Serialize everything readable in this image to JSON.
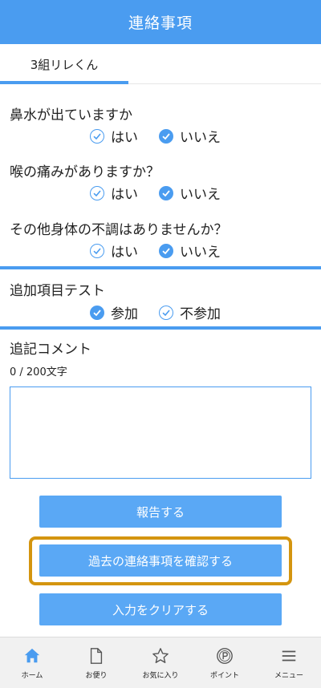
{
  "header": {
    "title": "連絡事項"
  },
  "tabs": [
    {
      "label": "3組リレくん"
    }
  ],
  "questions": [
    {
      "label": "鼻水が出ていますか",
      "options": [
        {
          "label": "はい",
          "checked": false
        },
        {
          "label": "いいえ",
          "checked": true
        }
      ]
    },
    {
      "label": "喉の痛みがありますか？",
      "options": [
        {
          "label": "はい",
          "checked": false
        },
        {
          "label": "いいえ",
          "checked": true
        }
      ]
    },
    {
      "label": "その他身体の不調はありませんか？",
      "options": [
        {
          "label": "はい",
          "checked": false
        },
        {
          "label": "いいえ",
          "checked": true
        }
      ]
    }
  ],
  "extra": {
    "label": "追加項目テスト",
    "options": [
      {
        "label": "参加",
        "checked": true
      },
      {
        "label": "不参加",
        "checked": false
      }
    ]
  },
  "comment": {
    "title": "追記コメント",
    "counter": "0 / 200文字",
    "value": ""
  },
  "buttons": {
    "report": "報告する",
    "history": "過去の連絡事項を確認する",
    "clear": "入力をクリアする"
  },
  "nav": [
    {
      "label": "ホーム",
      "icon": "home-icon"
    },
    {
      "label": "お便り",
      "icon": "document-icon"
    },
    {
      "label": "お気に入り",
      "icon": "star-icon"
    },
    {
      "label": "ポイント",
      "icon": "point-icon"
    },
    {
      "label": "メニュー",
      "icon": "menu-icon"
    }
  ],
  "colors": {
    "accent": "#4a9cf0",
    "button": "#5aa8f5",
    "highlight": "#d4950f"
  }
}
